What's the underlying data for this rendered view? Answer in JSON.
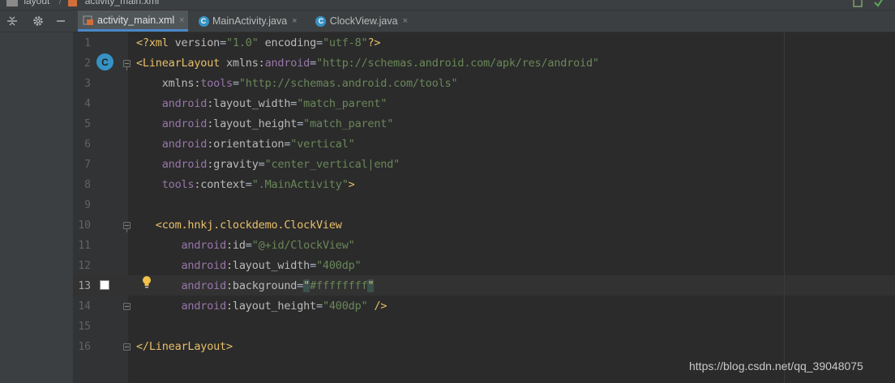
{
  "breadcrumbs": [
    "layout",
    "activity_main.xml"
  ],
  "tabs": [
    {
      "label": "activity_main.xml",
      "icon": "xml-layout-icon",
      "active": true
    },
    {
      "label": "MainActivity.java",
      "icon": "java-class-icon",
      "active": false
    },
    {
      "label": "ClockView.java",
      "icon": "java-class-icon",
      "active": false
    }
  ],
  "tab_close_glyph": "×",
  "class_icon_letter": "C",
  "editor": {
    "current_line": 13,
    "line_numbers": [
      "1",
      "2",
      "3",
      "4",
      "5",
      "6",
      "7",
      "8",
      "9",
      "10",
      "11",
      "12",
      "13",
      "14",
      "15",
      "16"
    ]
  },
  "color_preview": "#ffffff",
  "watermark": "https://blog.csdn.net/qq_39048075"
}
